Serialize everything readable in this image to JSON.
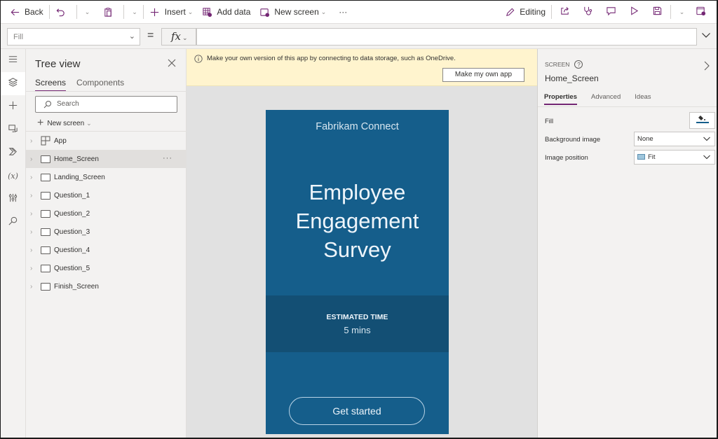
{
  "toolbar": {
    "back": "Back",
    "insert": "Insert",
    "add_data": "Add data",
    "new_screen": "New screen",
    "more": "···",
    "editing": "Editing"
  },
  "formula_bar": {
    "property": "Fill",
    "equals": "=",
    "fx": "fx",
    "formula": ""
  },
  "tree": {
    "title": "Tree view",
    "tabs": [
      {
        "label": "Screens",
        "active": true
      },
      {
        "label": "Components",
        "active": false
      }
    ],
    "search_placeholder": "Search",
    "new_screen": "New screen",
    "items": [
      {
        "label": "App",
        "type": "app",
        "selected": false
      },
      {
        "label": "Home_Screen",
        "type": "screen",
        "selected": true
      },
      {
        "label": "Landing_Screen",
        "type": "screen",
        "selected": false
      },
      {
        "label": "Question_1",
        "type": "screen",
        "selected": false
      },
      {
        "label": "Question_2",
        "type": "screen",
        "selected": false
      },
      {
        "label": "Question_3",
        "type": "screen",
        "selected": false
      },
      {
        "label": "Question_4",
        "type": "screen",
        "selected": false
      },
      {
        "label": "Question_5",
        "type": "screen",
        "selected": false
      },
      {
        "label": "Finish_Screen",
        "type": "screen",
        "selected": false
      }
    ],
    "more": "···"
  },
  "banner": {
    "message": "Make your own version of this app by connecting to data storage, such as OneDrive.",
    "button": "Make my own app"
  },
  "app_screen": {
    "brand": "Fabrikam Connect",
    "title_lines": [
      "Employee",
      "Engagement",
      "Survey"
    ],
    "estimated_label": "ESTIMATED TIME",
    "estimated_value": "5 mins",
    "cta": "Get started",
    "colors": {
      "background": "#155e8b",
      "band": "#134f74"
    }
  },
  "properties": {
    "kind": "SCREEN",
    "help": "?",
    "name": "Home_Screen",
    "tabs": [
      {
        "label": "Properties",
        "active": true
      },
      {
        "label": "Advanced",
        "active": false
      },
      {
        "label": "Ideas",
        "active": false
      }
    ],
    "rows": {
      "fill_label": "Fill",
      "background_image_label": "Background image",
      "background_image_value": "None",
      "image_position_label": "Image position",
      "image_position_value": "Fit"
    }
  },
  "colors": {
    "accent": "#742774",
    "banner_bg": "#fff4ce"
  }
}
